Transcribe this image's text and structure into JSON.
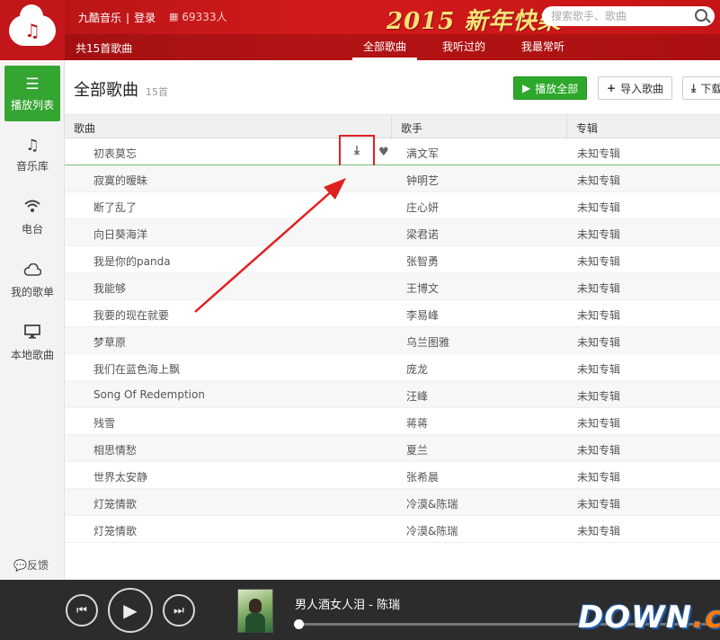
{
  "app": {
    "name": "九酷音乐",
    "login": "登录",
    "online_count": "69333人",
    "banner_text": "2015 新年快樂"
  },
  "search": {
    "placeholder": "搜索歌手、歌曲"
  },
  "subbar": {
    "count_label": "共15首歌曲",
    "tabs": [
      {
        "label": "全部歌曲",
        "active": true
      },
      {
        "label": "我听过的",
        "active": false
      },
      {
        "label": "我最常听",
        "active": false
      }
    ]
  },
  "nav": {
    "items": [
      {
        "label": "播放列表",
        "icon": "list-icon",
        "active": true
      },
      {
        "label": "音乐库",
        "icon": "music-note-icon",
        "active": false
      },
      {
        "label": "电台",
        "icon": "wifi-icon",
        "active": false
      },
      {
        "label": "我的歌单",
        "icon": "cloud-icon",
        "active": false
      },
      {
        "label": "本地歌曲",
        "icon": "monitor-icon",
        "active": false
      }
    ],
    "feedback": "反馈"
  },
  "main": {
    "title": "全部歌曲",
    "count": "15首",
    "buttons": {
      "play_all": "播放全部",
      "import": "导入歌曲",
      "download": "下载"
    },
    "columns": {
      "song": "歌曲",
      "artist": "歌手",
      "album": "专辑"
    },
    "songs": [
      {
        "song": "初表莫忘",
        "artist": "满文军",
        "album": "未知专辑"
      },
      {
        "song": "寂寞的暧昧",
        "artist": "钟明艺",
        "album": "未知专辑"
      },
      {
        "song": "断了乱了",
        "artist": "庄心妍",
        "album": "未知专辑"
      },
      {
        "song": "向日葵海洋",
        "artist": "梁君诺",
        "album": "未知专辑"
      },
      {
        "song": "我是你的panda",
        "artist": "张智勇",
        "album": "未知专辑"
      },
      {
        "song": "我能够",
        "artist": "王博文",
        "album": "未知专辑"
      },
      {
        "song": "我要的现在就要",
        "artist": "李易峰",
        "album": "未知专辑"
      },
      {
        "song": "梦草原",
        "artist": "乌兰图雅",
        "album": "未知专辑"
      },
      {
        "song": "我们在蓝色海上飘",
        "artist": "庞龙",
        "album": "未知专辑"
      },
      {
        "song": "Song Of Redemption",
        "artist": "汪峰",
        "album": "未知专辑"
      },
      {
        "song": "残雪",
        "artist": "蒋蒋",
        "album": "未知专辑"
      },
      {
        "song": "相思情愁",
        "artist": "夏兰",
        "album": "未知专辑"
      },
      {
        "song": "世界太安静",
        "artist": "张希晨",
        "album": "未知专辑"
      },
      {
        "song": "灯笼情歌",
        "artist": "冷漠&陈瑞",
        "album": "未知专辑"
      },
      {
        "song": "灯笼情歌",
        "artist": "冷漠&陈瑞",
        "album": "未知专辑"
      }
    ]
  },
  "player": {
    "now_playing": "男人酒女人泪 - 陈瑞",
    "progress_fraction": 0.0
  },
  "watermark": {
    "main": "DOWN",
    "dot": ".",
    "suffix": "cc"
  },
  "colors": {
    "brand_red": "#c3161a",
    "accent_green": "#2da82a",
    "annotation_red": "#e02020",
    "player_bg": "#2c2c2c"
  }
}
